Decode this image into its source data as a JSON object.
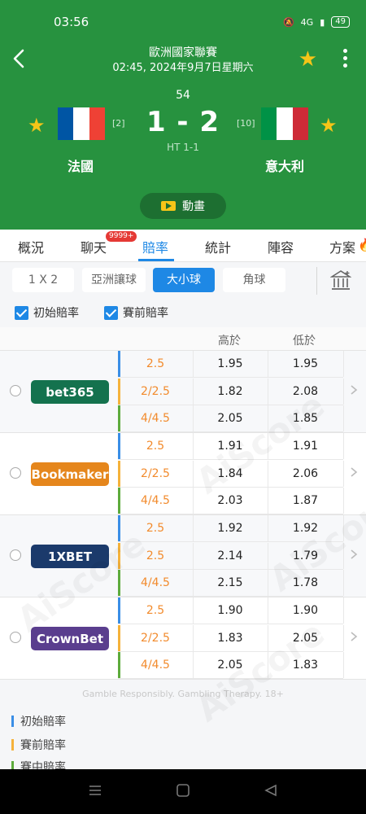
{
  "status": {
    "time": "03:56",
    "signal": "4G",
    "battery": "49"
  },
  "header": {
    "league": "歐洲國家聯賽",
    "kickoff": "02:45, 2024年9月7日星期六",
    "minute": "54",
    "score": "1 - 2",
    "halftime": "HT 1-1",
    "home": {
      "name": "法國",
      "rank": "[2]",
      "flag_colors": [
        "#0055a4",
        "#ffffff",
        "#ef4135"
      ]
    },
    "away": {
      "name": "意大利",
      "rank": "[10]",
      "flag_colors": [
        "#009246",
        "#ffffff",
        "#ce2b37"
      ]
    },
    "animation_label": "動畫"
  },
  "tabs": [
    {
      "label": "概況"
    },
    {
      "label": "聊天",
      "badge": "9999+"
    },
    {
      "label": "賠率",
      "active": true
    },
    {
      "label": "統計"
    },
    {
      "label": "陣容"
    },
    {
      "label": "方案"
    }
  ],
  "filters": [
    {
      "label": "1 X 2"
    },
    {
      "label": "亞洲讓球"
    },
    {
      "label": "大小球",
      "active": true
    },
    {
      "label": "角球"
    }
  ],
  "checks": {
    "initial": "初始賠率",
    "prematch": "賽前賠率"
  },
  "table": {
    "headers": {
      "over": "高於",
      "under": "低於"
    },
    "bookmakers": [
      {
        "name": "bet365",
        "color": "#14724e",
        "rows": [
          {
            "line": "2.5",
            "over": "1.95",
            "under": "1.95"
          },
          {
            "line": "2/2.5",
            "over": "1.82",
            "under": "2.08"
          },
          {
            "line": "4/4.5",
            "over": "2.05",
            "under": "1.85"
          }
        ]
      },
      {
        "name": "Bookmaker",
        "color": "#e5861c",
        "rows": [
          {
            "line": "2.5",
            "over": "1.91",
            "under": "1.91"
          },
          {
            "line": "2/2.5",
            "over": "1.84",
            "under": "2.06"
          },
          {
            "line": "4/4.5",
            "over": "2.03",
            "under": "1.87"
          }
        ]
      },
      {
        "name": "1XBET",
        "color": "#1b3a6b",
        "rows": [
          {
            "line": "2.5",
            "over": "1.92",
            "under": "1.92"
          },
          {
            "line": "2.5",
            "over": "2.14",
            "under": "1.79"
          },
          {
            "line": "4/4.5",
            "over": "2.15",
            "under": "1.78"
          }
        ]
      },
      {
        "name": "CrownBet",
        "color": "#5a3e8e",
        "rows": [
          {
            "line": "2.5",
            "over": "1.90",
            "under": "1.90"
          },
          {
            "line": "2/2.5",
            "over": "1.83",
            "under": "2.05"
          },
          {
            "line": "4/4.5",
            "over": "2.05",
            "under": "1.83"
          }
        ]
      }
    ]
  },
  "row_bar_colors": [
    "#3a8ee6",
    "#f5b23b",
    "#5dab3c"
  ],
  "footer": {
    "note": "Gamble Responsibly. Gambling Therapy. 18+"
  },
  "legend": [
    {
      "label": "初始賠率",
      "color": "#3a8ee6"
    },
    {
      "label": "賽前賠率",
      "color": "#f5b23b"
    },
    {
      "label": "賽中賠率",
      "color": "#5dab3c"
    }
  ],
  "watermark": "AiScore"
}
